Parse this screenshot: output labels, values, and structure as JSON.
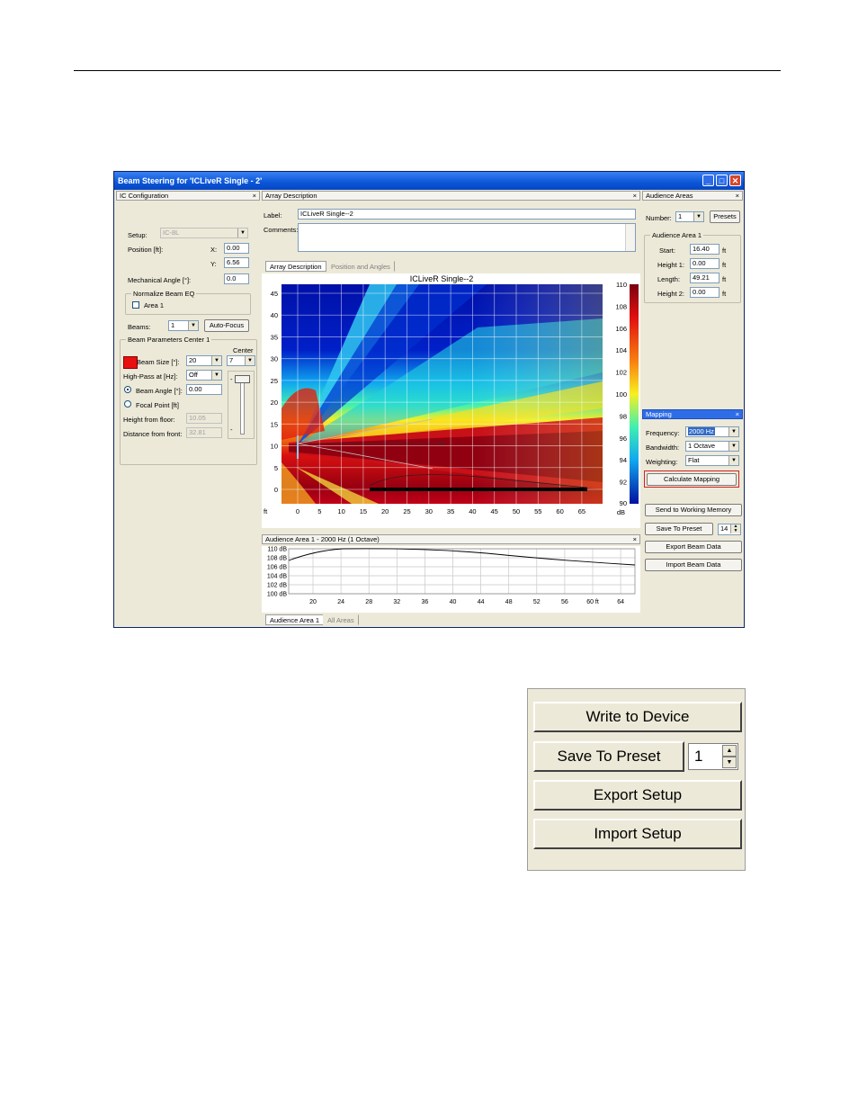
{
  "window": {
    "title": "Beam Steering for 'ICLiveR Single - 2'",
    "buttons": {
      "minimize": "_",
      "maximize": "□",
      "close": "✕"
    }
  },
  "ic_config": {
    "header": "IC Configuration",
    "close": "×",
    "setup_label": "Setup:",
    "setup_value": "IC-8L",
    "position_label": "Position [ft]:",
    "x_label": "X:",
    "x_value": "0.00",
    "y_label": "Y:",
    "y_value": "6.56",
    "mech_angle_label": "Mechanical Angle [°]:",
    "mech_angle_value": "0.0",
    "normalize_title": "Normalize Beam EQ",
    "area1_label": "Area 1",
    "beams_label": "Beams:",
    "beams_value": "1",
    "auto_focus": "Auto-Focus",
    "beam_params_title": "Beam Parameters Center 1",
    "beam_size_label": "Beam Size [°]:",
    "beam_size_value": "20",
    "center_label": "Center",
    "center_value": "7",
    "highpass_label": "High-Pass at [Hz]:",
    "highpass_value": "Off",
    "beam_angle_label": "Beam Angle [°]:",
    "beam_angle_value": "0.00",
    "focal_point_label": "Focal Point [ft]",
    "height_floor_label": "Height from floor:",
    "height_floor_value": "10.05",
    "distance_front_label": "Distance from front:",
    "distance_front_value": "32.81",
    "beam_color": "#e81010"
  },
  "array_desc": {
    "header": "Array Description",
    "close": "×",
    "label_label": "Label:",
    "label_value": "ICLiveR Single--2",
    "comments_label": "Comments:",
    "tab1": "Array Description",
    "tab2": "Position and Angles"
  },
  "heatmap": {
    "title": "ICLiveR Single--2",
    "x_unit": "ft",
    "x_ticks": [
      "0",
      "5",
      "10",
      "15",
      "20",
      "25",
      "30",
      "35",
      "40",
      "45",
      "50",
      "55",
      "60",
      "65"
    ],
    "y_ticks": [
      "45",
      "40",
      "35",
      "30",
      "25",
      "20",
      "15",
      "10",
      "5",
      "0"
    ],
    "colorbar_ticks": [
      "110",
      "108",
      "106",
      "104",
      "102",
      "100",
      "98",
      "96",
      "94",
      "92",
      "90"
    ],
    "colorbar_unit": "dB"
  },
  "response": {
    "header": "Audience Area 1 - 2000 Hz (1 Octave)",
    "close": "×",
    "y_ticks": [
      "110 dB",
      "108 dB",
      "106 dB",
      "104 dB",
      "102 dB",
      "100 dB"
    ],
    "x_ticks": [
      "20",
      "24",
      "28",
      "32",
      "36",
      "40",
      "44",
      "48",
      "52",
      "56",
      "60 ft",
      "64"
    ],
    "tab1": "Audience Area 1",
    "tab2": "All Areas"
  },
  "audience": {
    "header": "Audience Areas",
    "close": "×",
    "number_label": "Number:",
    "number_value": "1",
    "presets": "Presets",
    "group_title": "Audience Area 1",
    "start_label": "Start:",
    "start_value": "16.40",
    "height1_label": "Height 1:",
    "height1_value": "0.00",
    "length_label": "Length:",
    "length_value": "49.21",
    "height2_label": "Height 2:",
    "height2_value": "0.00",
    "unit": "ft"
  },
  "mapping": {
    "header": "Mapping",
    "close": "×",
    "frequency_label": "Frequency:",
    "frequency_value": "2000 Hz",
    "bandwidth_label": "Bandwidth:",
    "bandwidth_value": "1 Octave",
    "weighting_label": "Weighting:",
    "weighting_value": "Flat",
    "calculate": "Calculate Mapping",
    "highlight_color": "#d42020"
  },
  "actions": {
    "send": "Send to Working Memory",
    "save_preset": "Save To Preset",
    "preset_value": "14",
    "export": "Export Beam Data",
    "import": "Import Beam Data"
  },
  "zoom_panel": {
    "write": "Write to Device",
    "save_preset": "Save To Preset",
    "preset_value": "1",
    "export": "Export Setup",
    "import": "Import Setup"
  }
}
